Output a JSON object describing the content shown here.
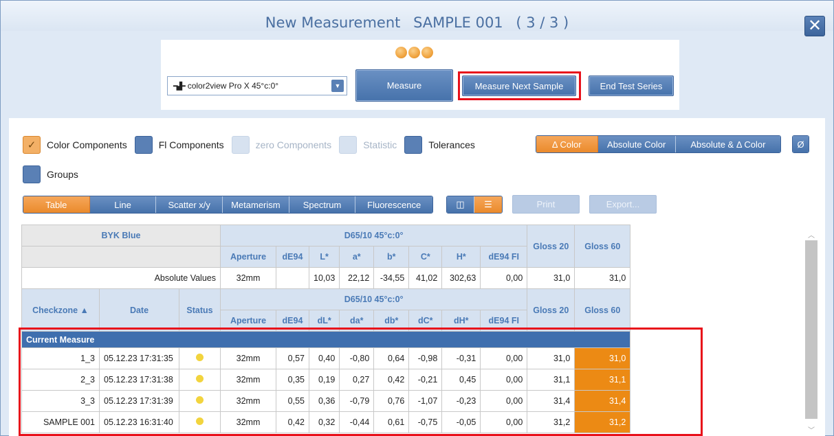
{
  "window": {
    "title_left": "New Measurement",
    "title_sample": "SAMPLE 001",
    "title_progress": "( 3 / 3 )",
    "close_label": "✕"
  },
  "toolbar": {
    "device": "color2view Pro X 45°c:0°",
    "measure": "Measure",
    "measure_next": "Measure Next Sample",
    "end_series": "End Test Series"
  },
  "options": {
    "color_components": "Color Components",
    "fl_components": "Fl Components",
    "zero_components": "zero Components",
    "statistic": "Statistic",
    "tolerances": "Tolerances",
    "groups": "Groups",
    "delta_color": "Δ Color",
    "absolute_color": "Absolute Color",
    "abs_delta_color": "Absolute & Δ Color",
    "avg_symbol": "Ø"
  },
  "views": {
    "table": "Table",
    "line": "Line",
    "scatter": "Scatter x/y",
    "metamerism": "Metamerism",
    "spectrum": "Spectrum",
    "fluorescence": "Fluorescence",
    "print": "Print",
    "export": "Export..."
  },
  "standard": {
    "name": "BYK Blue",
    "illuminant": "D65/10 45°c:0°",
    "absolute_label": "Absolute Values",
    "aperture": "32mm",
    "L": "10,03",
    "a": "22,12",
    "b": "-34,55",
    "C": "41,02",
    "H": "302,63",
    "dE94FI": "0,00",
    "gloss20": "31,0",
    "gloss60": "31,0"
  },
  "columns": {
    "aperture": "Aperture",
    "dE94": "dE94",
    "L": "L*",
    "a": "a*",
    "b": "b*",
    "C": "C*",
    "H": "H*",
    "dE94FI": "dE94 FI",
    "dL": "dL*",
    "da": "da*",
    "db": "db*",
    "dC": "dC*",
    "dH": "dH*",
    "gloss20": "Gloss 20",
    "gloss60": "Gloss 60",
    "checkzone": "Checkzone ▲",
    "date": "Date",
    "status": "Status"
  },
  "group_label": "Current Measure",
  "rows": [
    {
      "zone": "1_3",
      "date": "05.12.23 17:31:35",
      "ap": "32mm",
      "de": "0,57",
      "dl": "0,40",
      "da": "-0,80",
      "db": "0,64",
      "dc": "-0,98",
      "dh": "-0,31",
      "fl": "0,00",
      "g20": "31,0",
      "g60": "31,0"
    },
    {
      "zone": "2_3",
      "date": "05.12.23 17:31:38",
      "ap": "32mm",
      "de": "0,35",
      "dl": "0,19",
      "da": "0,27",
      "db": "0,42",
      "dc": "-0,21",
      "dh": "0,45",
      "fl": "0,00",
      "g20": "31,1",
      "g60": "31,1"
    },
    {
      "zone": "3_3",
      "date": "05.12.23 17:31:39",
      "ap": "32mm",
      "de": "0,55",
      "dl": "0,36",
      "da": "-0,79",
      "db": "0,76",
      "dc": "-1,07",
      "dh": "-0,23",
      "fl": "0,00",
      "g20": "31,4",
      "g60": "31,4"
    },
    {
      "zone": "SAMPLE 001",
      "date": "05.12.23 16:31:40",
      "ap": "32mm",
      "de": "0,42",
      "dl": "0,32",
      "da": "-0,44",
      "db": "0,61",
      "dc": "-0,75",
      "dh": "-0,05",
      "fl": "0,00",
      "g20": "31,2",
      "g60": "31,2"
    }
  ],
  "colors": {
    "accent": "#4672ab",
    "highlight": "#ec8a14",
    "status": "#f2d43e",
    "alert_outline": "#e8101a"
  }
}
